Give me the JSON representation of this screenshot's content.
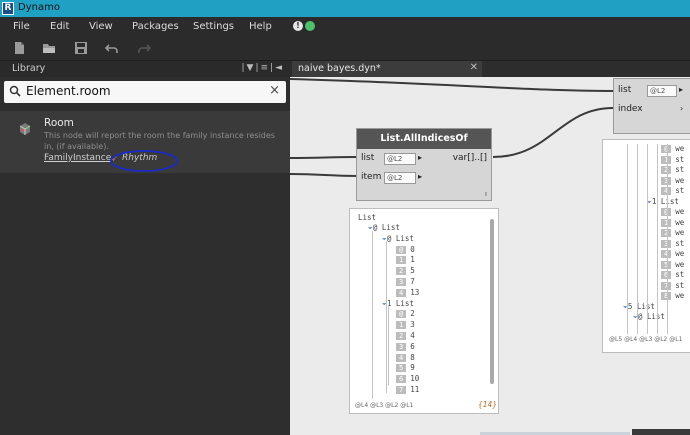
{
  "window": {
    "title": "Dynamo",
    "app_icon_letter": "R"
  },
  "menu": {
    "items": [
      "File",
      "Edit",
      "View",
      "Packages",
      "Settings",
      "Help"
    ]
  },
  "library": {
    "header_label": "Library",
    "search_value": "Element.room",
    "result": {
      "title": "Room",
      "description": "This node will report the room the family instance resides in, (if available).",
      "category": "FamilyInstance",
      "package": "Rhythm"
    }
  },
  "tabs": [
    {
      "label": "naive bayes.dyn*"
    }
  ],
  "nodes": {
    "all_indices": {
      "title": "List.AllIndicesOf",
      "inputs": [
        {
          "name": "list",
          "lacing": "@L2"
        },
        {
          "name": "item",
          "lacing": "@L2"
        }
      ],
      "output": "var[]..[]"
    },
    "get_item": {
      "inputs": [
        {
          "name": "list",
          "lacing": "@L2"
        },
        {
          "name": "index"
        }
      ]
    }
  },
  "preview_left": {
    "root": "List",
    "lines": [
      {
        "t": "@ List"
      },
      {
        "t": "@ List"
      },
      {
        "i": "@",
        "v": "0"
      },
      {
        "i": "1",
        "v": "1"
      },
      {
        "i": "2",
        "v": "5"
      },
      {
        "i": "3",
        "v": "7"
      },
      {
        "i": "4",
        "v": "13"
      },
      {
        "t": "1 List"
      },
      {
        "i": "@",
        "v": "2"
      },
      {
        "i": "1",
        "v": "3"
      },
      {
        "i": "2",
        "v": "4"
      },
      {
        "i": "3",
        "v": "6"
      },
      {
        "i": "4",
        "v": "8"
      },
      {
        "i": "5",
        "v": "9"
      },
      {
        "i": "6",
        "v": "10"
      },
      {
        "i": "7",
        "v": "11"
      }
    ],
    "footer": "@L4 @L3 @L2 @L1",
    "count": "{14}"
  },
  "preview_right": {
    "lines": [
      {
        "i": "@",
        "v": "we"
      },
      {
        "i": "1",
        "v": "st"
      },
      {
        "i": "2",
        "v": "st"
      },
      {
        "i": "3",
        "v": "we"
      },
      {
        "i": "4",
        "v": "st"
      },
      {
        "t": "1 List"
      },
      {
        "i": "@",
        "v": "we"
      },
      {
        "i": "1",
        "v": "we"
      },
      {
        "i": "2",
        "v": "we"
      },
      {
        "i": "3",
        "v": "st"
      },
      {
        "i": "4",
        "v": "we"
      },
      {
        "i": "5",
        "v": "we"
      },
      {
        "i": "6",
        "v": "st"
      },
      {
        "i": "7",
        "v": "st"
      },
      {
        "i": "8",
        "v": "we"
      },
      {
        "t": "5 List"
      },
      {
        "t": "@ List"
      }
    ],
    "footer": "@L5 @L4 @L3 @L2 @L1"
  }
}
